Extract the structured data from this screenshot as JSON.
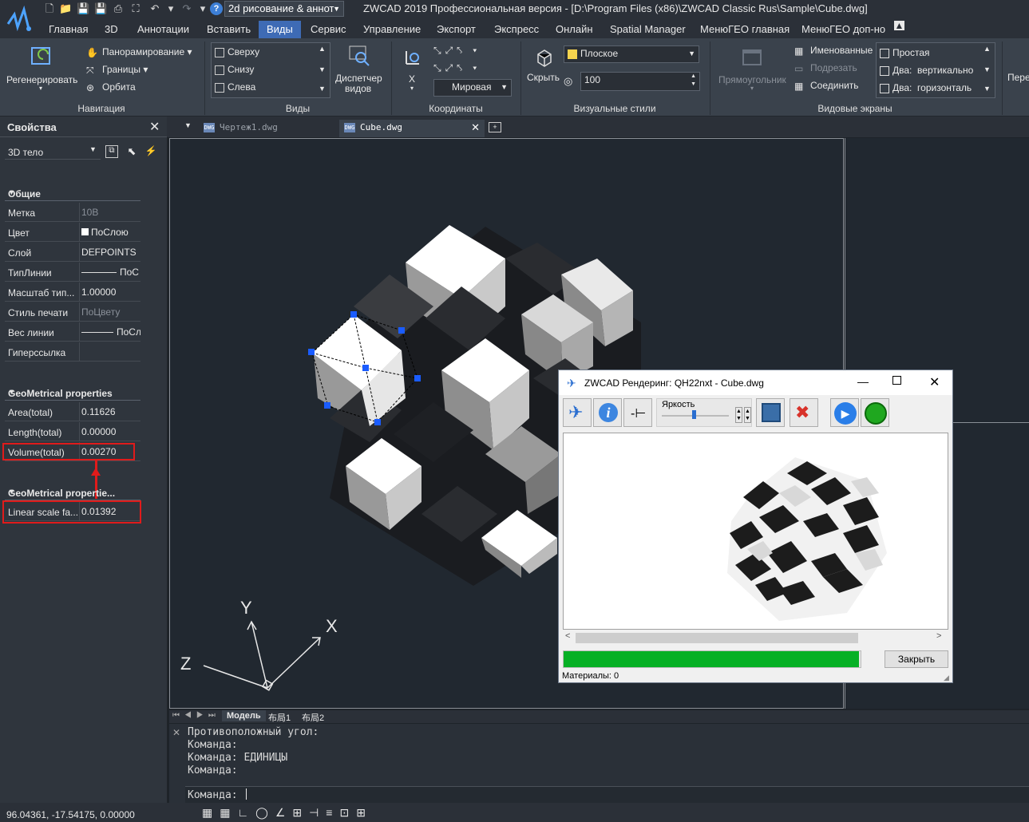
{
  "title_bar": {
    "workspace": "2d рисование & аннот",
    "app_title": "ZWCAD 2019 Профессиональная версия - [D:\\Program Files (x86)\\ZWCAD Classic Rus\\Sample\\Cube.dwg]"
  },
  "ribbon_tabs": [
    "Главная",
    "3D",
    "Аннотации",
    "Вставить",
    "Виды",
    "Сервис",
    "Управление",
    "Экспорт",
    "Экспресс",
    "Онлайн",
    "Spatial Manager",
    "МенюГЕО главная",
    "МенюГЕО доп-но"
  ],
  "ribbon": {
    "navigation": {
      "title": "Навигация",
      "regen": "Регенерировать",
      "pan": "Панорамирование",
      "extents": "Границы",
      "orbit": "Орбита"
    },
    "views": {
      "title": "Виды",
      "items": [
        "Сверху",
        "Снизу",
        "Слева"
      ],
      "manager_line1": "Диспетчер",
      "manager_line2": "видов"
    },
    "coordinates": {
      "title": "Координаты",
      "x": "X",
      "world": "Мировая"
    },
    "visual_styles": {
      "title": "Визуальные стили",
      "hide": "Скрыть",
      "style": "Плоское",
      "value": "100"
    },
    "viewports": {
      "title": "Видовые экраны",
      "rect": "Прямоугольник",
      "named": "Именованные",
      "fit": "Подрезать",
      "join": "Соединить",
      "simple": "Простая",
      "two_v_a": "Два:",
      "two_v_b": "вертикально",
      "two_h_a": "Два:",
      "two_h_b": "горизонталь",
      "more": "Пере"
    }
  },
  "properties": {
    "title": "Свойства",
    "object_type": "3D тело",
    "group_general": "Общие",
    "general_rows": [
      {
        "key": "Метка",
        "value": "10B"
      },
      {
        "key": "Цвет",
        "value": "ПоСлою"
      },
      {
        "key": "Слой",
        "value": "DEFPOINTS"
      },
      {
        "key": "ТипЛинии",
        "value": "ПоС"
      },
      {
        "key": "Масштаб тип...",
        "value": "1.00000"
      },
      {
        "key": "Стиль печати",
        "value": "ПоЦвету"
      },
      {
        "key": "Вес линии",
        "value": "ПоСл"
      },
      {
        "key": "Гиперссылка",
        "value": ""
      }
    ],
    "group_geo1": "GeoMetrical properties",
    "geo1_rows": [
      {
        "key": "Area(total)",
        "value": "0.11626"
      },
      {
        "key": "Length(total)",
        "value": "0.00000"
      },
      {
        "key": "Volume(total)",
        "value": "0.00270"
      }
    ],
    "group_geo2": "GeoMetrical propertie...",
    "geo2_rows": [
      {
        "key": "Linear scale fa...",
        "value": "0.01392"
      }
    ]
  },
  "doc_tabs": [
    "Чертеж1.dwg",
    "Cube.dwg"
  ],
  "layout_tabs": [
    "Модель",
    "布局1",
    "布局2"
  ],
  "ucs": {
    "x": "X",
    "y": "Y",
    "z": "Z"
  },
  "command_lines": [
    "Противоположный угол:",
    "Команда:",
    "Команда: ЕДИНИЦЫ",
    "Команда:"
  ],
  "command_prompt": "Команда:",
  "coordinates": "96.04361, -17.54175, 0.00000",
  "render_dialog": {
    "title": "ZWCAD Рендеринг: QH22nxt - Cube.dwg",
    "brightness": "Яркость",
    "close_btn": "Закрыть",
    "materials": "Материалы: 0",
    "progress": 0.994
  },
  "colors": {
    "accent": "#3e6bb5",
    "highlight": "#e01b1b",
    "progress": "#06b025"
  }
}
